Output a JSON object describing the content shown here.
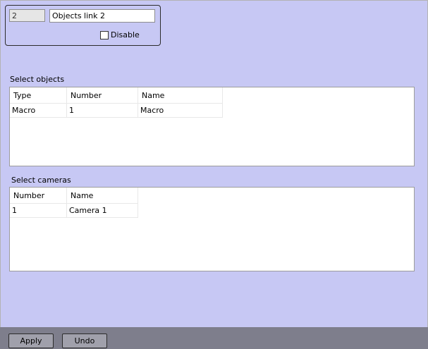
{
  "header": {
    "id_value": "2",
    "name_value": "Objects link 2",
    "disable_label": "Disable",
    "disable_checked": false
  },
  "objects": {
    "label": "Select objects",
    "columns": [
      "Type",
      "Number",
      "Name"
    ],
    "rows": [
      [
        "Macro",
        "1",
        "Macro"
      ]
    ]
  },
  "cameras": {
    "label": "Select cameras",
    "columns": [
      "Number",
      "Name"
    ],
    "rows": [
      [
        "1",
        "Camera 1"
      ]
    ]
  },
  "footer": {
    "apply_label": "Apply",
    "undo_label": "Undo"
  }
}
